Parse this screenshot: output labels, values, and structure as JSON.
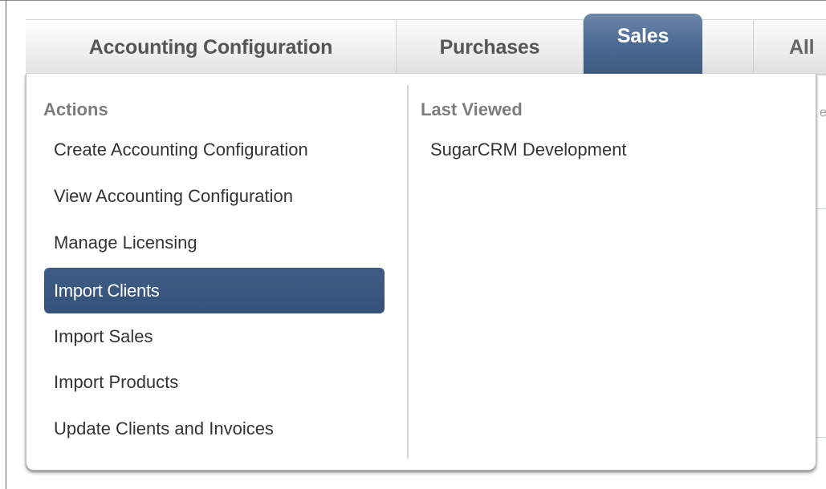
{
  "navbar": {
    "tabs": [
      {
        "label": "Accounting Configuration"
      },
      {
        "label": "Purchases"
      },
      {
        "label": "Sales",
        "active": true
      },
      {
        "label": "All"
      }
    ]
  },
  "dropdown": {
    "actions_heading": "Actions",
    "actions": [
      {
        "label": "Create Accounting Configuration"
      },
      {
        "label": "View Accounting Configuration"
      },
      {
        "label": "Manage Licensing"
      },
      {
        "label": "Import Clients",
        "highlighted": true
      },
      {
        "label": "Import Sales"
      },
      {
        "label": "Import Products"
      },
      {
        "label": "Update Clients and Invoices"
      }
    ],
    "last_viewed_heading": "Last Viewed",
    "last_viewed": [
      {
        "label": "SugarCRM Development"
      }
    ]
  },
  "colors": {
    "active_tab": "#4b6a92",
    "highlight": "#3a567d",
    "heading": "#7c7c7c",
    "text": "#333333"
  }
}
